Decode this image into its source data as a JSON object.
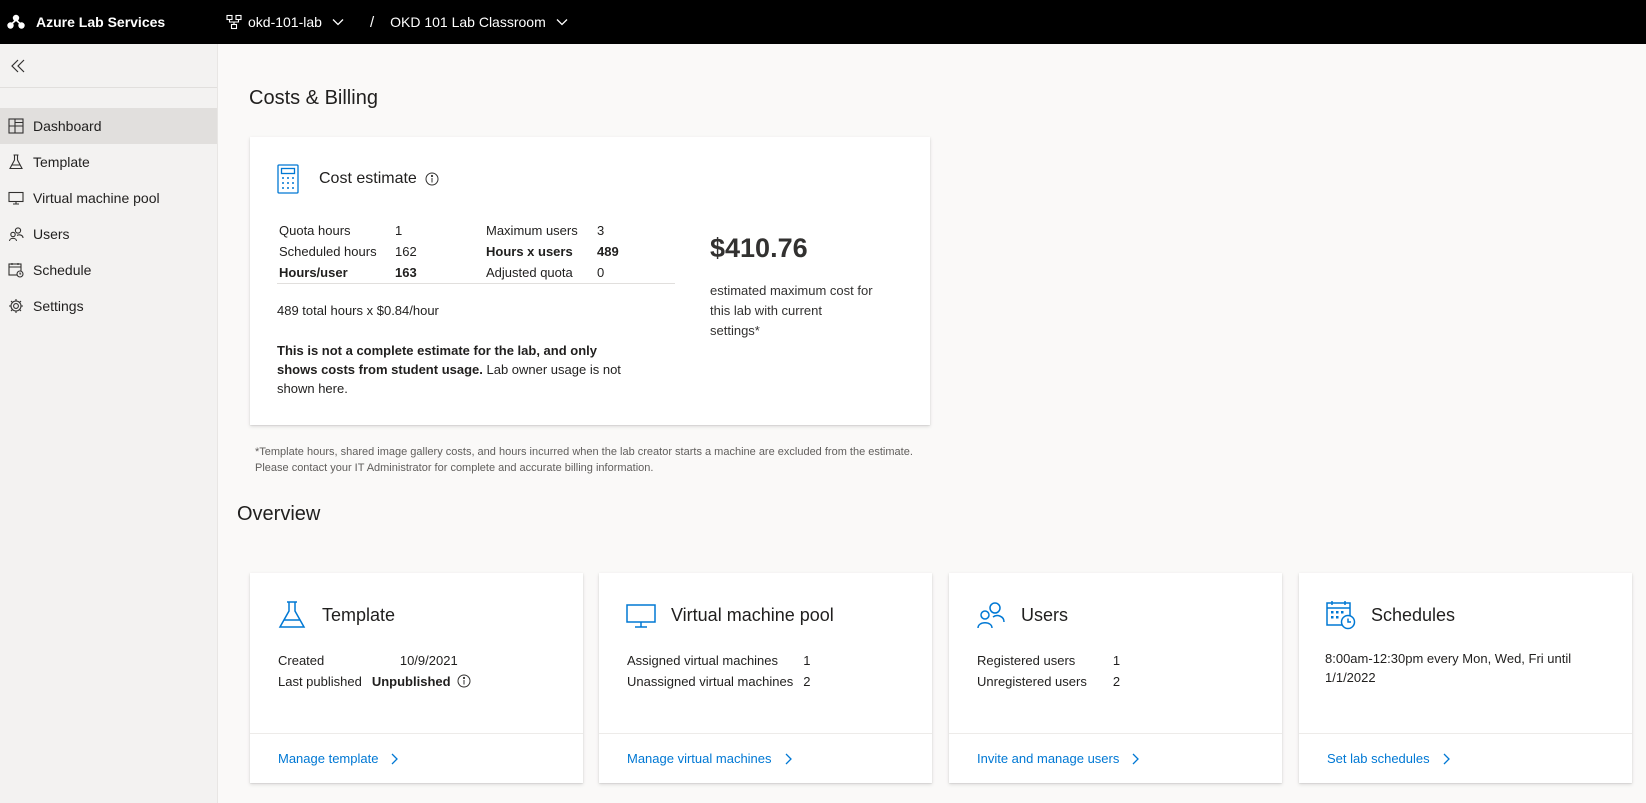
{
  "app": {
    "title": "Azure Lab Services"
  },
  "breadcrumb": {
    "lab": "okd-101-lab",
    "separator": "/",
    "classroom": "OKD 101 Lab Classroom"
  },
  "sidebar": {
    "items": [
      {
        "label": "Dashboard",
        "icon": "dashboard-icon",
        "active": true
      },
      {
        "label": "Template",
        "icon": "flask-icon"
      },
      {
        "label": "Virtual machine pool",
        "icon": "monitor-icon"
      },
      {
        "label": "Users",
        "icon": "users-icon"
      },
      {
        "label": "Schedule",
        "icon": "calendar-icon"
      },
      {
        "label": "Settings",
        "icon": "gear-icon"
      }
    ]
  },
  "costs": {
    "heading": "Costs & Billing",
    "card_title": "Cost estimate",
    "stats": {
      "quota_hours_label": "Quota hours",
      "quota_hours": "1",
      "scheduled_hours_label": "Scheduled hours",
      "scheduled_hours": "162",
      "hours_user_label": "Hours/user",
      "hours_user": "163",
      "max_users_label": "Maximum users",
      "max_users": "3",
      "hours_x_users_label": "Hours x users",
      "hours_x_users": "489",
      "adjusted_quota_label": "Adjusted quota",
      "adjusted_quota": "0"
    },
    "total_line": "489 total hours x $0.84/hour",
    "disclaimer_bold": "This is not a complete estimate for the lab, and only shows costs from student usage.",
    "disclaimer_rest": " Lab owner usage is not shown here.",
    "amount": "$410.76",
    "amount_caption": "estimated maximum cost for this lab with current settings*",
    "footnote": "*Template hours, shared image gallery costs, and hours incurred when the lab creator starts a machine are excluded from the estimate. Please contact your IT Administrator for complete and accurate billing information."
  },
  "overview": {
    "heading": "Overview",
    "template": {
      "title": "Template",
      "created_label": "Created",
      "created": "10/9/2021",
      "published_label": "Last published",
      "published": "Unpublished",
      "link": "Manage template"
    },
    "vm_pool": {
      "title": "Virtual machine pool",
      "assigned_label": "Assigned virtual machines",
      "assigned": "1",
      "unassigned_label": "Unassigned virtual machines",
      "unassigned": "2",
      "link": "Manage virtual machines"
    },
    "users": {
      "title": "Users",
      "registered_label": "Registered users",
      "registered": "1",
      "unregistered_label": "Unregistered users",
      "unregistered": "2",
      "link": "Invite and manage users"
    },
    "schedules": {
      "title": "Schedules",
      "text": "8:00am-12:30pm every Mon, Wed, Fri until 1/1/2022",
      "link": "Set lab schedules"
    }
  },
  "colors": {
    "accent": "#0078d4",
    "topbar": "#000000",
    "sidebar_active": "#e1dfdd"
  }
}
